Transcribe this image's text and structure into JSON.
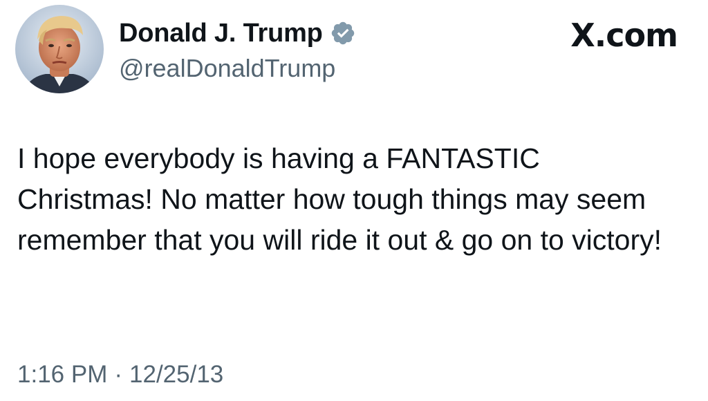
{
  "author": {
    "display_name": "Donald J. Trump",
    "handle": "@realDonaldTrump",
    "verified": true,
    "verified_badge_color": "#829aab",
    "avatar_icon": "profile-photo"
  },
  "brand": {
    "label": "X.com"
  },
  "tweet": {
    "text": "I hope everybody is having a FANTASTIC Christmas! No matter how tough things may seem remember that you will ride it out & go on to victory!",
    "time": "1:16 PM",
    "separator": "·",
    "date": "12/25/13"
  },
  "colors": {
    "text_primary": "#0f1419",
    "text_secondary": "#536471",
    "background": "#ffffff"
  }
}
